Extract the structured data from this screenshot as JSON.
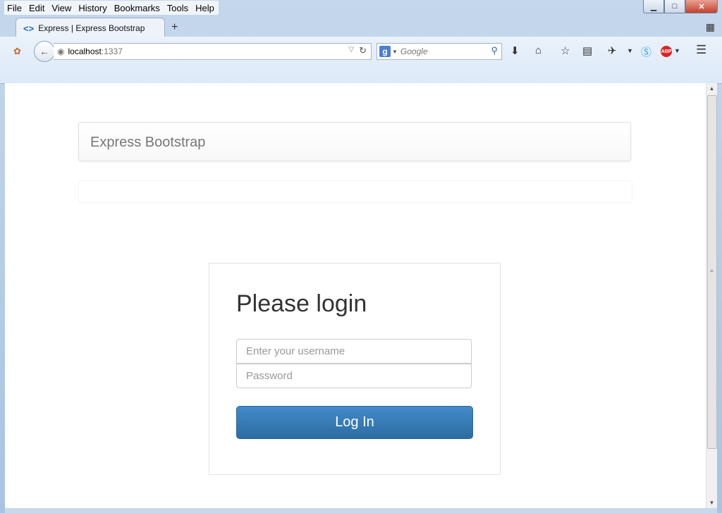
{
  "menubar": {
    "items": [
      "File",
      "Edit",
      "View",
      "History",
      "Bookmarks",
      "Tools",
      "Help"
    ]
  },
  "window": {
    "minimize": "▁",
    "maximize": "□",
    "close": "✕"
  },
  "tab": {
    "title": "Express | Express Bootstrap",
    "new_tab": "+"
  },
  "navbar": {
    "url_host": "localhost",
    "url_port": ":1337",
    "search_engine": "g",
    "search_placeholder": "Google"
  },
  "page": {
    "brand": "Express Bootstrap",
    "login": {
      "title": "Please login",
      "username_placeholder": "Enter your username",
      "password_placeholder": "Password",
      "button": "Log In"
    }
  },
  "colors": {
    "primary": "#428bca",
    "chrome": "#dce9f8"
  }
}
